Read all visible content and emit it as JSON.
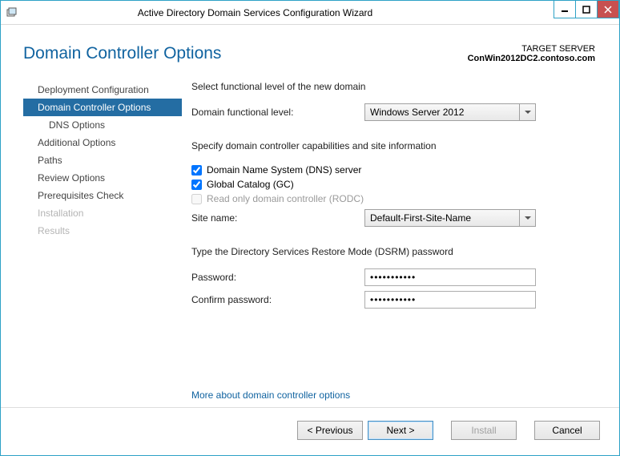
{
  "window": {
    "title": "Active Directory Domain Services Configuration Wizard"
  },
  "header": {
    "page_title": "Domain Controller Options",
    "target_label": "TARGET SERVER",
    "target_value": "ConWin2012DC2.contoso.com"
  },
  "sidebar": {
    "items": [
      {
        "label": "Deployment Configuration",
        "disabled": false
      },
      {
        "label": "Domain Controller Options",
        "disabled": false,
        "selected": true
      },
      {
        "label": "DNS Options",
        "disabled": false,
        "sub": true
      },
      {
        "label": "Additional Options",
        "disabled": false
      },
      {
        "label": "Paths",
        "disabled": false
      },
      {
        "label": "Review Options",
        "disabled": false
      },
      {
        "label": "Prerequisites Check",
        "disabled": false
      },
      {
        "label": "Installation",
        "disabled": true
      },
      {
        "label": "Results",
        "disabled": true
      }
    ]
  },
  "main": {
    "functional_section": "Select functional level of the new domain",
    "func_label": "Domain functional level:",
    "func_value": "Windows Server 2012",
    "caps_section": "Specify domain controller capabilities and site information",
    "chk_dns": "Domain Name System (DNS) server",
    "chk_gc": "Global Catalog (GC)",
    "chk_rodc": "Read only domain controller (RODC)",
    "site_label": "Site name:",
    "site_value": "Default-First-Site-Name",
    "dsrm_section": "Type the Directory Services Restore Mode (DSRM) password",
    "pw_label": "Password:",
    "pw_confirm_label": "Confirm password:",
    "pw_value": "•••••••••••",
    "more_link": "More about domain controller options"
  },
  "footer": {
    "previous": "< Previous",
    "next": "Next >",
    "install": "Install",
    "cancel": "Cancel"
  }
}
